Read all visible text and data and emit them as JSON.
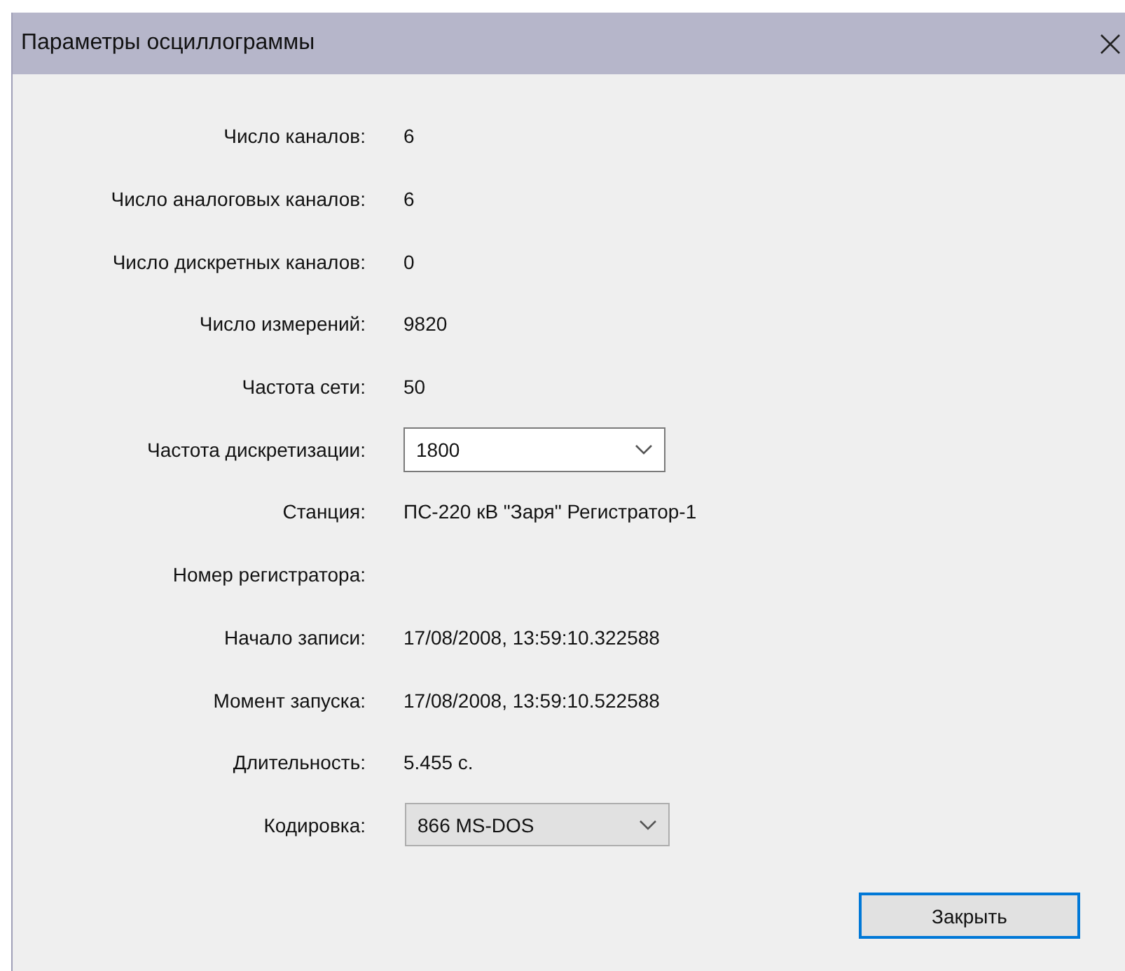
{
  "window": {
    "title": "Параметры осциллограммы"
  },
  "rows": [
    {
      "kind": "text",
      "label": "Число каналов:",
      "value": "6"
    },
    {
      "kind": "text",
      "label": "Число аналоговых каналов:",
      "value": "6"
    },
    {
      "kind": "text",
      "label": "Число дискретных каналов:",
      "value": "0"
    },
    {
      "kind": "text",
      "label": "Число измерений:",
      "value": "9820"
    },
    {
      "kind": "text",
      "label": "Частота сети:",
      "value": "50"
    },
    {
      "kind": "combo-edit",
      "label": "Частота дискретизации:",
      "value": "1800"
    },
    {
      "kind": "text",
      "label": "Станция:",
      "value": "ПС-220 кВ \"Заря\" Регистратор-1"
    },
    {
      "kind": "empty",
      "label": "Номер регистратора:"
    },
    {
      "kind": "text",
      "label": "Начало записи:",
      "value": "17/08/2008, 13:59:10.322588"
    },
    {
      "kind": "text",
      "label": "Момент запуска:",
      "value": "17/08/2008, 13:59:10.522588"
    },
    {
      "kind": "text",
      "label": "Длительность:",
      "value": "5.455 с."
    },
    {
      "kind": "combo-list",
      "label": "Кодировка:",
      "value": "866 MS-DOS"
    }
  ],
  "buttons": [
    {
      "label": "Закрыть",
      "selected": true
    }
  ]
}
